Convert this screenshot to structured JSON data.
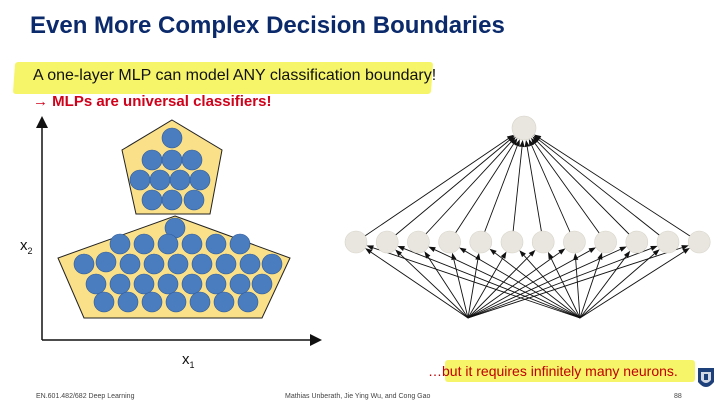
{
  "slide": {
    "title": "Even More Complex Decision Boundaries",
    "subtitle": "A one-layer MLP can model ANY classification boundary!",
    "claim": "→ MLPs are universal classifiers!",
    "footnote": "…but it requires infinitely many neurons.",
    "course": "EN.601.482/682 Deep Learning",
    "authors": "Mathias Unberath, Jie Ying Wu, and Cong Gao",
    "page": "88"
  },
  "figure": {
    "x_axis_label": "x",
    "x_axis_sub": "1",
    "y_axis_label": "x",
    "y_axis_sub": "2"
  },
  "network": {
    "hidden_units": 12,
    "output_units": 1,
    "input_units": 2
  },
  "colors": {
    "title": "#0b2a6b",
    "claim": "#d0021b",
    "highlight": "#f6f56a",
    "region_fill": "#fbe08a",
    "point": "#4a7cc0",
    "neuron": "#e8e6df"
  },
  "icons": {
    "logo": "university-shield-icon"
  }
}
